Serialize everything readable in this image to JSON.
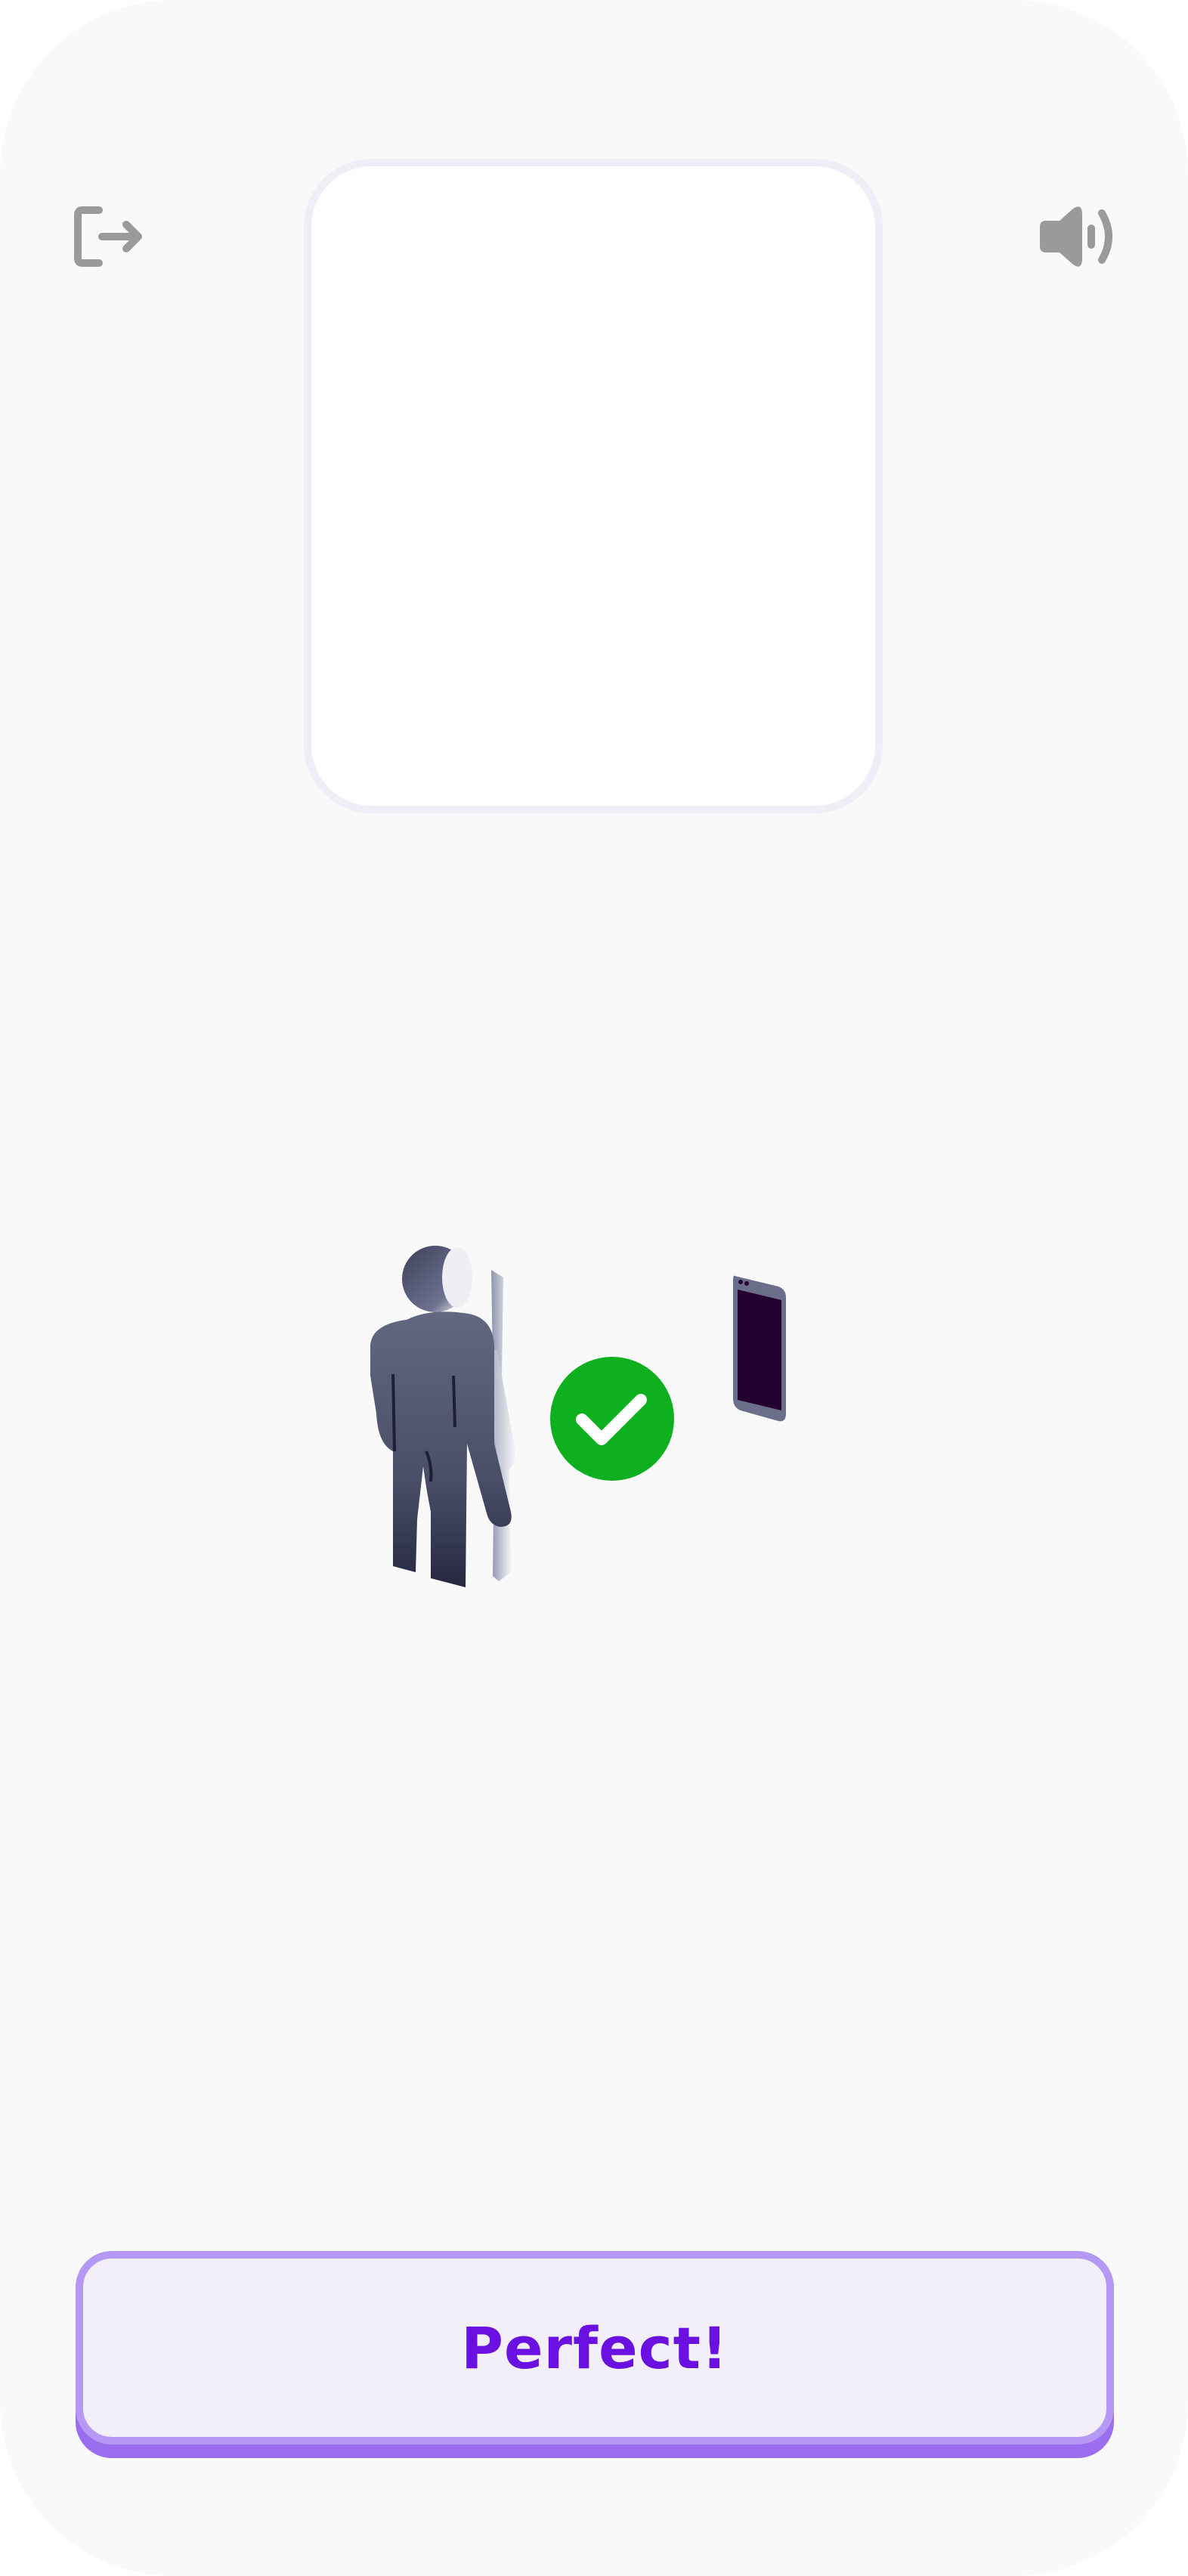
{
  "header": {
    "exit_icon": "exit-icon",
    "sound_icon": "speaker-volume-icon"
  },
  "camera_preview": {
    "state": "empty"
  },
  "illustration": {
    "figure": "person-standing-icon",
    "status_icon": "checkmark-circle-icon",
    "device": "phone-icon",
    "status_color": "#0fb020"
  },
  "footer": {
    "button_label": "Perfect!",
    "accent_color": "#6a10e0"
  }
}
